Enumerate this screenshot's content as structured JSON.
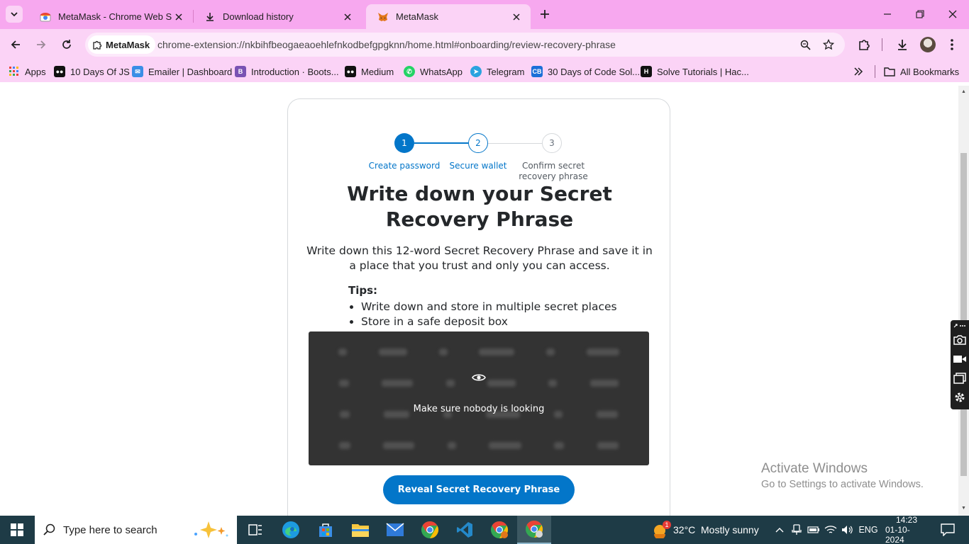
{
  "browser": {
    "tabs": [
      {
        "title": "MetaMask - Chrome Web Store",
        "icon": "chrome-web-store-icon",
        "active": false
      },
      {
        "title": "Download history",
        "icon": "download-icon",
        "active": false
      },
      {
        "title": "MetaMask",
        "icon": "metamask-fox-icon",
        "active": true
      }
    ],
    "omnibox": {
      "site_chip": "MetaMask",
      "url": "chrome-extension://nkbihfbeogaeaoehlefnkodbefgpgknn/home.html#onboarding/review-recovery-phrase"
    },
    "bookmarks": [
      {
        "label": "Apps",
        "icon": "apps-grid-icon"
      },
      {
        "label": "10 Days Of JS",
        "icon": "medium-icon"
      },
      {
        "label": "Emailer | Dashboard",
        "icon": "emailer-icon"
      },
      {
        "label": "Introduction · Boots...",
        "icon": "bootstrap-icon"
      },
      {
        "label": "Medium",
        "icon": "medium-icon"
      },
      {
        "label": "WhatsApp",
        "icon": "whatsapp-icon"
      },
      {
        "label": "Telegram",
        "icon": "telegram-icon"
      },
      {
        "label": "30 Days of Code Sol...",
        "icon": "codebook-icon"
      },
      {
        "label": "Solve Tutorials | Hac...",
        "icon": "hackerrank-icon"
      }
    ],
    "all_bookmarks": "All Bookmarks"
  },
  "onboarding": {
    "steps": [
      {
        "number": "1",
        "label": "Create password",
        "state": "complete"
      },
      {
        "number": "2",
        "label": "Secure wallet",
        "state": "current"
      },
      {
        "number": "3",
        "label": "Confirm secret recovery phrase",
        "state": "upcoming"
      }
    ],
    "heading_line1": "Write down your Secret",
    "heading_line2": "Recovery Phrase",
    "description": "Write down this 12-word Secret Recovery Phrase and save it in a place that you trust and only you can access.",
    "tips_title": "Tips:",
    "tips": [
      "Write down and store in multiple secret places",
      "Store in a safe deposit box"
    ],
    "secret_overlay_text": "Make sure nobody is looking",
    "reveal_button": "Reveal Secret Recovery Phrase"
  },
  "watermark": {
    "line1": "Activate Windows",
    "line2": "Go to Settings to activate Windows."
  },
  "taskbar": {
    "search_placeholder": "Type here to search",
    "weather_temp": "32°C",
    "weather_desc": "Mostly sunny",
    "weather_badge": "1",
    "language": "ENG",
    "time": "14:23",
    "date": "01-10-2024"
  },
  "colors": {
    "accent": "#0376c9",
    "tab_strip": "#f7a8ef",
    "toolbar": "#fbd3f6",
    "secret_box": "#333333",
    "taskbar": "#1e3b46"
  }
}
